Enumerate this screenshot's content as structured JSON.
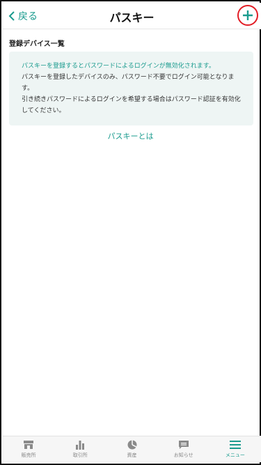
{
  "header": {
    "back_label": "戻る",
    "title": "パスキー"
  },
  "section": {
    "label": "登録デバイス一覧"
  },
  "notice": {
    "line1": "パスキーを登録するとパスワードによるログインが無効化されます。",
    "line2": "パスキーを登録したデバイスのみ、パスワード不要でログイン可能となります。",
    "line3": "引き続きパスワードによるログインを希望する場合はパスワード認証を有効化してください。"
  },
  "link": {
    "label": "パスキーとは"
  },
  "tabbar": {
    "tabs": [
      {
        "label": "販売所",
        "icon": "store-icon"
      },
      {
        "label": "取引所",
        "icon": "bar-chart-icon"
      },
      {
        "label": "資産",
        "icon": "pie-chart-icon"
      },
      {
        "label": "お知らせ",
        "icon": "message-icon"
      },
      {
        "label": "メニュー",
        "icon": "menu-icon"
      }
    ],
    "active_index": 4
  },
  "colors": {
    "accent": "#1a9b8e",
    "highlight": "#e21d25",
    "notice_bg": "#eef5f4"
  }
}
